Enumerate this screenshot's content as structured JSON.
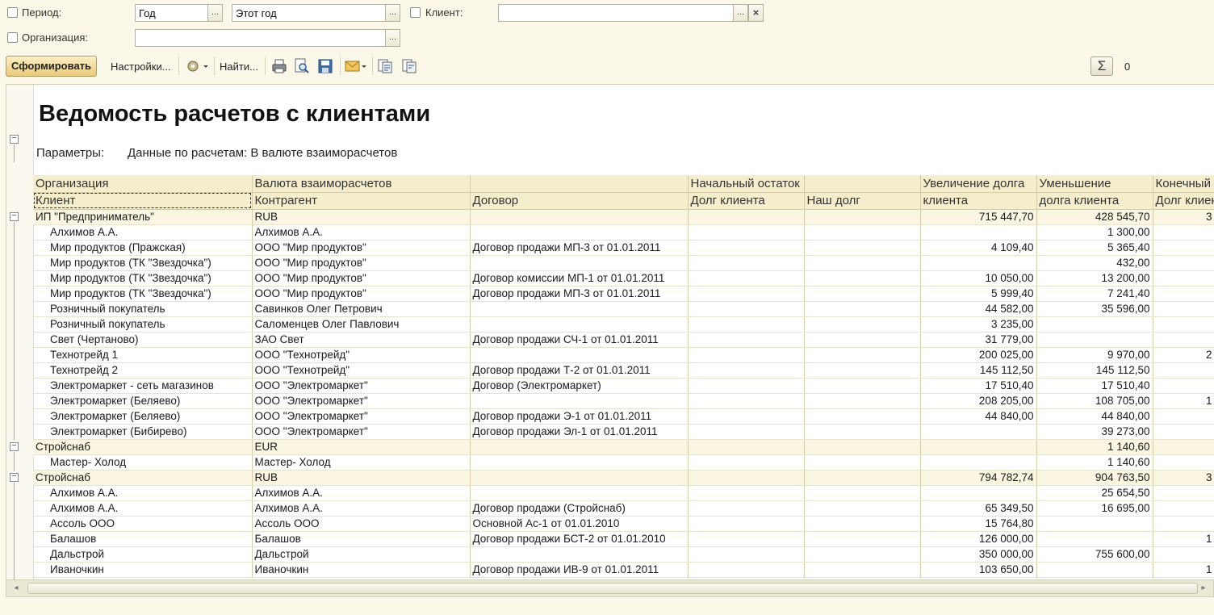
{
  "filters": {
    "period_label": "Период:",
    "period_type": "Год",
    "period_value": "Этот год",
    "client_label": "Клиент:",
    "client_value": "",
    "org_label": "Организация:",
    "org_value": "",
    "ellipsis": "...",
    "clear": "×"
  },
  "toolbar": {
    "generate": "Сформировать",
    "settings": "Настройки...",
    "find": "Найти...",
    "sum_value": "0",
    "sum_symbol": "Σ"
  },
  "report": {
    "title": "Ведомость расчетов с клиентами",
    "params_label": "Параметры:",
    "params_value": "Данные по расчетам: В валюте взаиморасчетов",
    "headers1": [
      "Организация",
      "Валюта взаиморасчетов",
      "",
      "Начальный остаток",
      "",
      "Увеличение долга",
      "Уменьшение",
      "Конечный"
    ],
    "headers2": [
      "Клиент",
      "Контрагент",
      "Договор",
      "Долг клиента",
      "Наш долг",
      "клиента",
      "долга клиента",
      "Долг клиен"
    ],
    "rows": [
      {
        "g": true,
        "c": [
          "ИП \"Предприниматель\"",
          "RUB",
          "",
          "",
          "",
          "715 447,70",
          "428 545,70",
          "3"
        ]
      },
      {
        "g": false,
        "c": [
          "Алхимов А.А.",
          "Алхимов А.А.",
          "",
          "",
          "",
          "",
          "1 300,00",
          ""
        ]
      },
      {
        "g": false,
        "c": [
          "Мир продуктов (Пражская)",
          "ООО \"Мир продуктов\"",
          "Договор продажи МП-3 от 01.01.2011",
          "",
          "",
          "4 109,40",
          "5 365,40",
          ""
        ]
      },
      {
        "g": false,
        "c": [
          "Мир продуктов (ТК \"Звездочка\")",
          "ООО \"Мир продуктов\"",
          "",
          "",
          "",
          "",
          "432,00",
          ""
        ]
      },
      {
        "g": false,
        "c": [
          "Мир продуктов (ТК \"Звездочка\")",
          "ООО \"Мир продуктов\"",
          "Договор комиссии МП-1 от 01.01.2011",
          "",
          "",
          "10 050,00",
          "13 200,00",
          ""
        ]
      },
      {
        "g": false,
        "c": [
          "Мир продуктов (ТК \"Звездочка\")",
          "ООО \"Мир продуктов\"",
          "Договор продажи МП-3 от 01.01.2011",
          "",
          "",
          "5 999,40",
          "7 241,40",
          ""
        ]
      },
      {
        "g": false,
        "c": [
          "Розничный покупатель",
          "Савинков Олег Петрович",
          "",
          "",
          "",
          "44 582,00",
          "35 596,00",
          ""
        ]
      },
      {
        "g": false,
        "c": [
          "Розничный покупатель",
          "Саломенцев Олег Павлович",
          "",
          "",
          "",
          "3 235,00",
          "",
          ""
        ]
      },
      {
        "g": false,
        "c": [
          "Свет (Чертаново)",
          "ЗАО Свет",
          "Договор продажи СЧ-1 от 01.01.2011",
          "",
          "",
          "31 779,00",
          "",
          ""
        ]
      },
      {
        "g": false,
        "c": [
          "Технотрейд 1",
          "ООО \"Технотрейд\"",
          "",
          "",
          "",
          "200 025,00",
          "9 970,00",
          "2"
        ]
      },
      {
        "g": false,
        "c": [
          "Технотрейд 2",
          "ООО \"Технотрейд\"",
          "Договор продажи Т-2 от 01.01.2011",
          "",
          "",
          "145 112,50",
          "145 112,50",
          ""
        ]
      },
      {
        "g": false,
        "c": [
          "Электромаркет - сеть магазинов",
          "ООО \"Электромаркет\"",
          "Договор (Электромаркет)",
          "",
          "",
          "17 510,40",
          "17 510,40",
          ""
        ]
      },
      {
        "g": false,
        "c": [
          "Электромаркет (Беляево)",
          "ООО \"Электромаркет\"",
          "",
          "",
          "",
          "208 205,00",
          "108 705,00",
          "1"
        ]
      },
      {
        "g": false,
        "c": [
          "Электромаркет (Беляево)",
          "ООО \"Электромаркет\"",
          "Договор продажи Э-1 от 01.01.2011",
          "",
          "",
          "44 840,00",
          "44 840,00",
          ""
        ]
      },
      {
        "g": false,
        "c": [
          "Электромаркет (Бибирево)",
          "ООО \"Электромаркет\"",
          "Договор продажи Эл-1 от 01.01.2011",
          "",
          "",
          "",
          "39 273,00",
          ""
        ]
      },
      {
        "g": true,
        "c": [
          "Стройснаб",
          "EUR",
          "",
          "",
          "",
          "",
          "1 140,60",
          ""
        ]
      },
      {
        "g": false,
        "c": [
          "Мастер- Холод",
          "Мастер- Холод",
          "",
          "",
          "",
          "",
          "1 140,60",
          ""
        ]
      },
      {
        "g": true,
        "c": [
          "Стройснаб",
          "RUB",
          "",
          "",
          "",
          "794 782,74",
          "904 763,50",
          "3"
        ]
      },
      {
        "g": false,
        "c": [
          "Алхимов А.А.",
          "Алхимов А.А.",
          "",
          "",
          "",
          "",
          "25 654,50",
          ""
        ]
      },
      {
        "g": false,
        "c": [
          "Алхимов А.А.",
          "Алхимов А.А.",
          "Договор продажи (Стройснаб)",
          "",
          "",
          "65 349,50",
          "16 695,00",
          ""
        ]
      },
      {
        "g": false,
        "c": [
          "Ассоль ООО",
          "Ассоль ООО",
          "Основной Ас-1 от 01.01.2010",
          "",
          "",
          "15 764,80",
          "",
          ""
        ]
      },
      {
        "g": false,
        "c": [
          "Балашов",
          "Балашов",
          "Договор продажи БСТ-2 от 01.01.2010",
          "",
          "",
          "126 000,00",
          "",
          "1"
        ]
      },
      {
        "g": false,
        "c": [
          "Дальстрой",
          "Дальстрой",
          "",
          "",
          "",
          "350 000,00",
          "755 600,00",
          ""
        ]
      },
      {
        "g": false,
        "c": [
          "Иваночкин",
          "Иваночкин",
          "Договор продажи ИВ-9 от 01.01.2011",
          "",
          "",
          "103 650,00",
          "",
          "1"
        ]
      }
    ]
  }
}
